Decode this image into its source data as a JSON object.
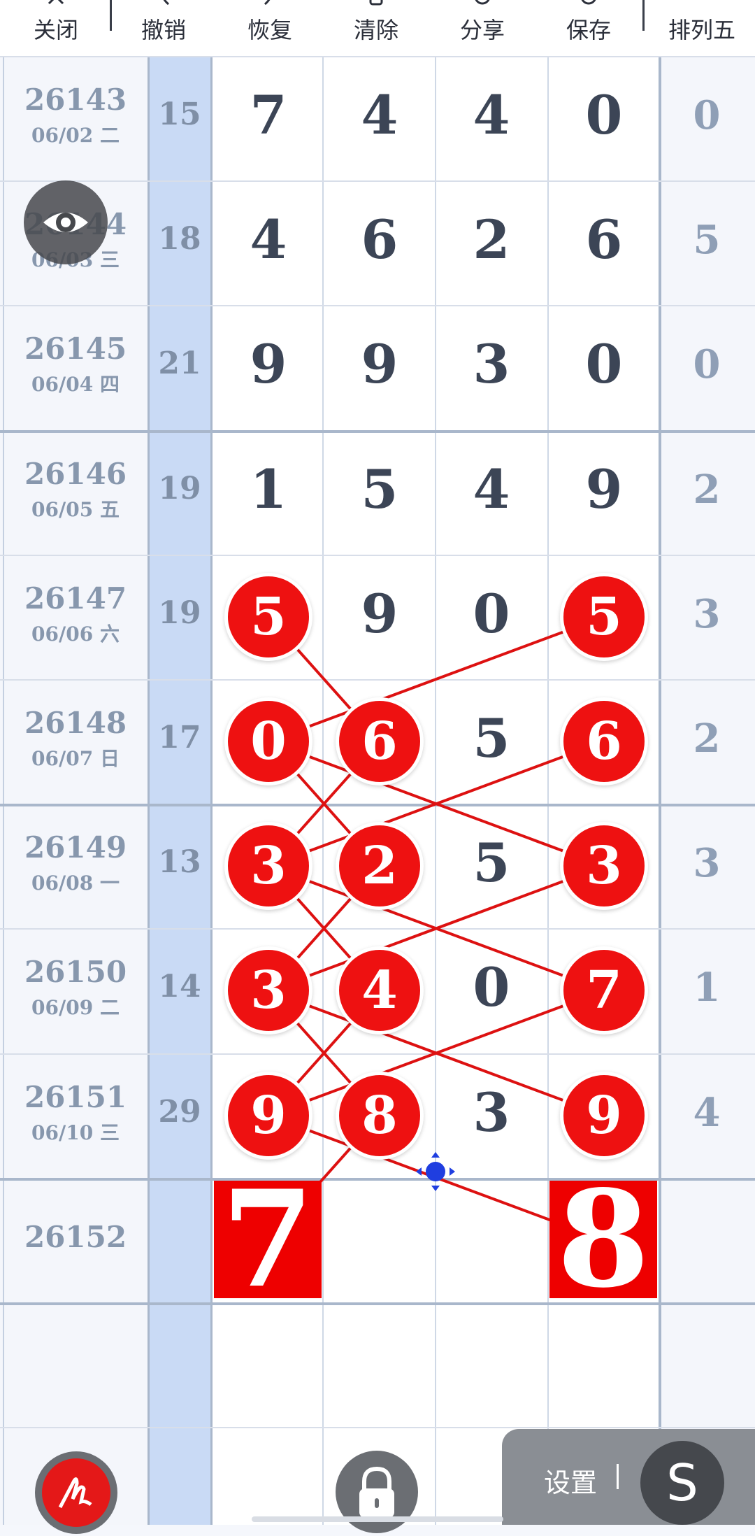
{
  "toolbar": {
    "items": [
      {
        "label": "关闭",
        "icon": "close-icon"
      },
      {
        "label": "撤销",
        "icon": "undo-icon"
      },
      {
        "label": "恢复",
        "icon": "redo-icon"
      },
      {
        "label": "清除",
        "icon": "clear-icon"
      },
      {
        "label": "分享",
        "icon": "share-icon"
      },
      {
        "label": "保存",
        "icon": "save-icon"
      },
      {
        "label": "排列五",
        "icon": ""
      }
    ]
  },
  "rows": [
    {
      "issue": "26143",
      "date": "06/02 二",
      "sum": "15",
      "digits": [
        "7",
        "4",
        "4",
        "0"
      ],
      "last": "0"
    },
    {
      "issue": "26144",
      "date": "06/03 三",
      "sum": "18",
      "digits": [
        "4",
        "6",
        "2",
        "6"
      ],
      "last": "5"
    },
    {
      "issue": "26145",
      "date": "06/04 四",
      "sum": "21",
      "digits": [
        "9",
        "9",
        "3",
        "0"
      ],
      "last": "0"
    },
    {
      "issue": "26146",
      "date": "06/05 五",
      "sum": "19",
      "digits": [
        "1",
        "5",
        "4",
        "9"
      ],
      "last": "2"
    },
    {
      "issue": "26147",
      "date": "06/06 六",
      "sum": "19",
      "digits": [
        "5",
        "9",
        "0",
        "5"
      ],
      "last": "3"
    },
    {
      "issue": "26148",
      "date": "06/07 日",
      "sum": "17",
      "digits": [
        "0",
        "6",
        "5",
        "6"
      ],
      "last": "2"
    },
    {
      "issue": "26149",
      "date": "06/08 一",
      "sum": "13",
      "digits": [
        "3",
        "2",
        "5",
        "3"
      ],
      "last": "3"
    },
    {
      "issue": "26150",
      "date": "06/09 二",
      "sum": "14",
      "digits": [
        "3",
        "4",
        "0",
        "7"
      ],
      "last": "1"
    },
    {
      "issue": "26151",
      "date": "06/10 三",
      "sum": "29",
      "digits": [
        "9",
        "8",
        "3",
        "9"
      ],
      "last": "4"
    },
    {
      "issue": "26152",
      "date": "",
      "sum": "",
      "digits": [
        "7",
        "",
        "",
        "8"
      ],
      "last": ""
    }
  ],
  "highlights": [
    {
      "row": 4,
      "col": 0
    },
    {
      "row": 4,
      "col": 3
    },
    {
      "row": 5,
      "col": 0
    },
    {
      "row": 5,
      "col": 1
    },
    {
      "row": 5,
      "col": 3
    },
    {
      "row": 6,
      "col": 0
    },
    {
      "row": 6,
      "col": 1
    },
    {
      "row": 6,
      "col": 3
    },
    {
      "row": 7,
      "col": 0
    },
    {
      "row": 7,
      "col": 1
    },
    {
      "row": 7,
      "col": 3
    },
    {
      "row": 8,
      "col": 0
    },
    {
      "row": 8,
      "col": 1
    },
    {
      "row": 8,
      "col": 3
    }
  ],
  "prediction_boxes": [
    {
      "row": 9,
      "col": 0
    },
    {
      "row": 9,
      "col": 3
    }
  ],
  "connections": [
    [
      [
        4,
        0
      ],
      [
        5,
        1
      ]
    ],
    [
      [
        4,
        3
      ],
      [
        5,
        0
      ]
    ],
    [
      [
        5,
        0
      ],
      [
        6,
        3
      ]
    ],
    [
      [
        5,
        0
      ],
      [
        6,
        1
      ]
    ],
    [
      [
        5,
        1
      ],
      [
        6,
        0
      ]
    ],
    [
      [
        5,
        3
      ],
      [
        6,
        0
      ]
    ],
    [
      [
        6,
        0
      ],
      [
        7,
        3
      ]
    ],
    [
      [
        6,
        0
      ],
      [
        7,
        1
      ]
    ],
    [
      [
        6,
        1
      ],
      [
        7,
        0
      ]
    ],
    [
      [
        6,
        3
      ],
      [
        7,
        0
      ]
    ],
    [
      [
        7,
        0
      ],
      [
        8,
        3
      ]
    ],
    [
      [
        7,
        0
      ],
      [
        8,
        1
      ]
    ],
    [
      [
        7,
        1
      ],
      [
        8,
        0
      ]
    ],
    [
      [
        7,
        3
      ],
      [
        8,
        0
      ]
    ],
    [
      [
        8,
        0
      ],
      [
        9,
        3
      ]
    ],
    [
      [
        8,
        1
      ],
      [
        9,
        0
      ]
    ]
  ],
  "bottom": {
    "settings_label": "设置",
    "s_button_label": "S"
  },
  "colors": {
    "ball": "#ee1111",
    "line": "#dd1111",
    "sum_column": "#c9daf5",
    "digits_bg": "#ffffff"
  }
}
